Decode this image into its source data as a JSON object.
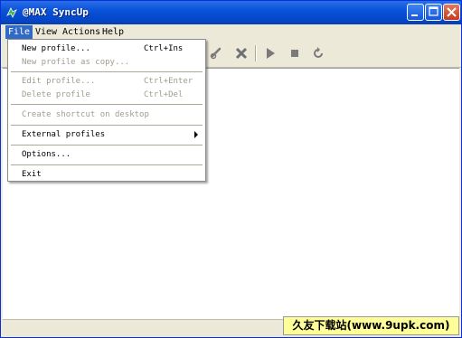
{
  "window": {
    "title": "@MAX SyncUp"
  },
  "menubar": {
    "items": [
      {
        "label": "File"
      },
      {
        "label": "View"
      },
      {
        "label": "Actions"
      },
      {
        "label": "Help"
      }
    ]
  },
  "file_menu": {
    "items": [
      {
        "label": "New profile...",
        "shortcut": "Ctrl+Ins",
        "enabled": true
      },
      {
        "label": "New profile as copy...",
        "shortcut": "",
        "enabled": false
      },
      {
        "label": "Edit profile...",
        "shortcut": "Ctrl+Enter",
        "enabled": false
      },
      {
        "label": "Delete profile",
        "shortcut": "Ctrl+Del",
        "enabled": false
      },
      {
        "label": "Create shortcut on desktop",
        "shortcut": "",
        "enabled": false
      },
      {
        "label": "External profiles",
        "shortcut": "",
        "enabled": true,
        "submenu": true
      },
      {
        "label": "Options...",
        "shortcut": "",
        "enabled": true
      },
      {
        "label": "Exit",
        "shortcut": "",
        "enabled": true
      }
    ]
  },
  "toolbar": {
    "icons": [
      "link-icon",
      "delete-icon",
      "play-icon",
      "stop-icon",
      "refresh-icon"
    ]
  },
  "watermark": {
    "text": "久友下载站(www.9upk.com)"
  }
}
